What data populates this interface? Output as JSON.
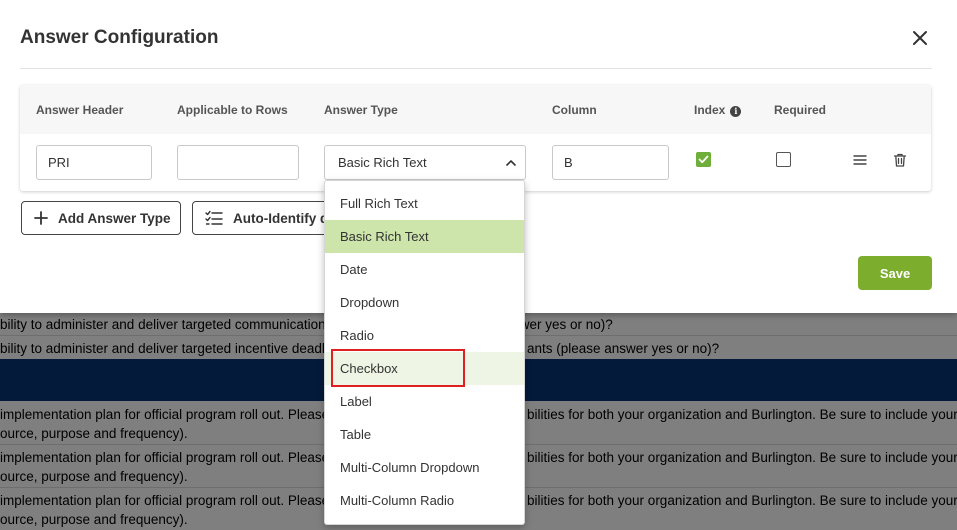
{
  "modal": {
    "title": "Answer Configuration",
    "save_label": "Save"
  },
  "table": {
    "headers": {
      "answer_header": "Answer Header",
      "applicable_rows": "Applicable to Rows",
      "answer_type": "Answer Type",
      "column": "Column",
      "index": "Index",
      "required": "Required"
    },
    "row": {
      "answer_header_value": "PRI",
      "applicable_rows_value": "",
      "answer_type_value": "Basic Rich Text",
      "column_value": "B",
      "index_checked": true,
      "required_checked": false
    }
  },
  "buttons": {
    "add_answer_type": "Add Answer Type",
    "auto_identify": "Auto-Identify d"
  },
  "dropdown": {
    "options": [
      "Full Rich Text",
      "Basic Rich Text",
      "Date",
      "Dropdown",
      "Radio",
      "Checkbox",
      "Label",
      "Table",
      "Multi-Column Dropdown",
      "Multi-Column Radio"
    ],
    "selected": "Basic Rich Text",
    "highlighted": "Checkbox"
  },
  "background": {
    "row1_left": "bility to administer and deliver targeted communications",
    "row1_right": "swer yes or no)?",
    "row2_left": "bility to administer and deliver targeted incentive deadli",
    "row2_right": "ants (please answer yes or no)?",
    "row3_line1_left": "implementation plan for official program roll out. Please",
    "row3_line1_right": "bilities for both your organization and Burlington. Be sure to include your",
    "row3_line2": "ource, purpose and frequency).",
    "row4_line1_left": "implementation plan for official program roll out. Please",
    "row4_line1_right": "bilities for both your organization and Burlington. Be sure to include your",
    "row4_line2": "ource, purpose and frequency).",
    "row5_line1_left": "implementation plan for official program roll out. Please",
    "row5_line1_right": "bilities for both your organization and Burlington. Be sure to include your",
    "row5_line2": "ource, purpose and frequency)."
  },
  "colors": {
    "accent_green": "#7cad2c",
    "selected_option": "#cde4ab",
    "highlight_red": "#e02020",
    "navy_band": "#041a3a"
  }
}
